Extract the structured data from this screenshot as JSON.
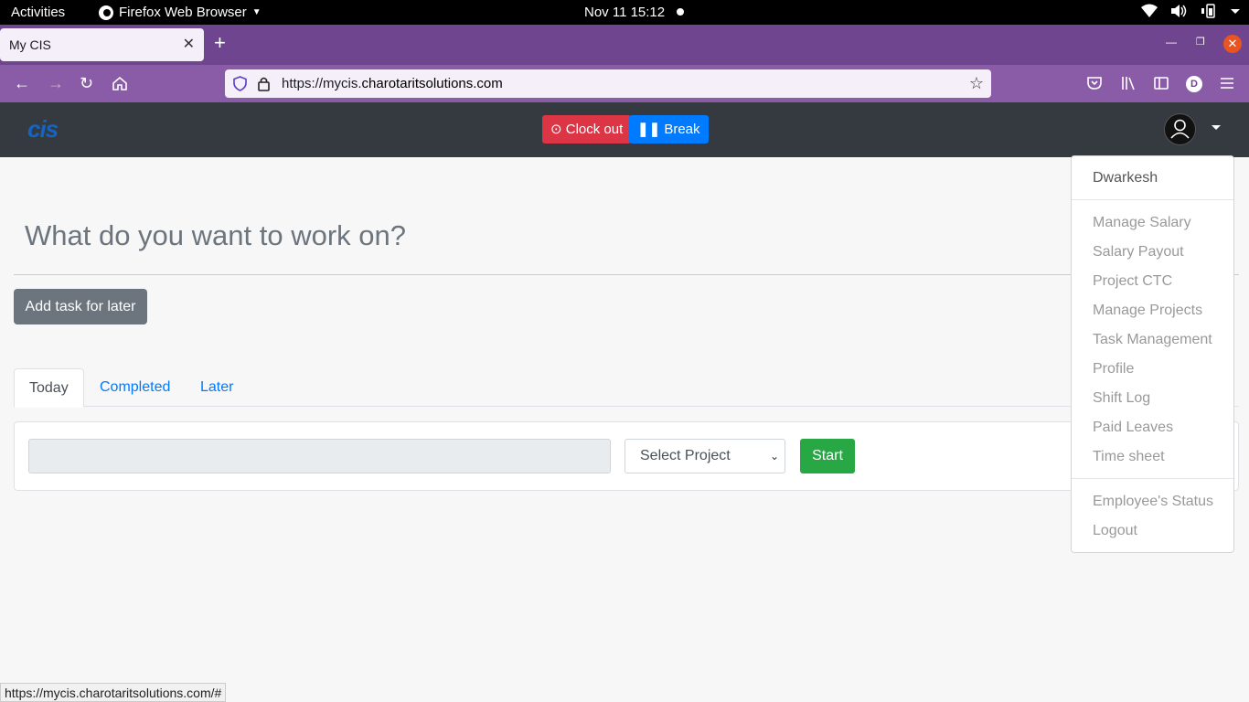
{
  "system_bar": {
    "activities": "Activities",
    "app_name": "Firefox Web Browser",
    "clock": "Nov 11  15:12"
  },
  "browser": {
    "tab_title": "My CIS",
    "url_prefix": "https://mycis.",
    "url_domain": "charotaritsolutions.com",
    "profile_initial": "D",
    "status_url": "https://mycis.charotaritsolutions.com/#"
  },
  "header": {
    "logo": "cis",
    "clock_out_label": "Clock out",
    "break_label": "Break"
  },
  "main": {
    "heading": "What do you want to work on?",
    "add_task_label": "Add task for later",
    "tabs": [
      {
        "label": "Today"
      },
      {
        "label": "Completed"
      },
      {
        "label": "Later"
      }
    ],
    "task_input_value": "",
    "project_select_value": "Select Project",
    "start_label": "Start"
  },
  "user_menu": {
    "user_name": "Dwarkesh",
    "items": [
      {
        "label": "Manage Salary"
      },
      {
        "label": "Salary Payout"
      },
      {
        "label": "Project CTC"
      },
      {
        "label": "Manage Projects"
      },
      {
        "label": "Task Management"
      },
      {
        "label": "Profile"
      },
      {
        "label": "Shift Log"
      },
      {
        "label": "Paid Leaves"
      },
      {
        "label": "Time sheet"
      }
    ],
    "footer_items": [
      {
        "label": "Employee's Status"
      },
      {
        "label": "Logout"
      }
    ]
  },
  "colors": {
    "tabstrip": "#6f4590",
    "navbar": "#8a5ba7",
    "header": "#343a40",
    "danger": "#dc3545",
    "primary": "#007bff",
    "success": "#28a745",
    "secondary": "#6c757d"
  }
}
